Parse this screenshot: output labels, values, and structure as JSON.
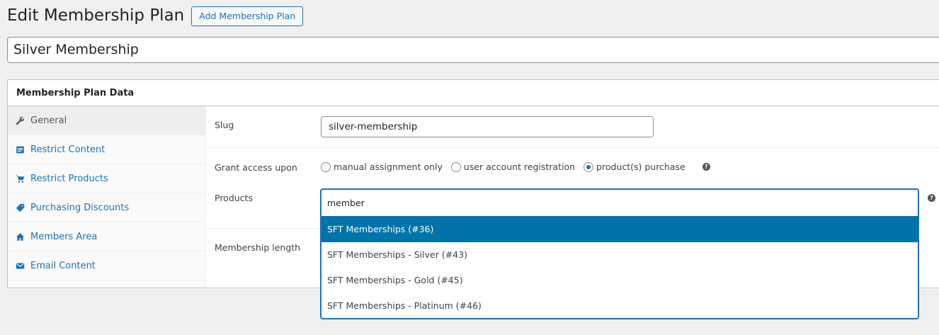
{
  "header": {
    "title": "Edit Membership Plan",
    "add_button_label": "Add Membership Plan"
  },
  "plan_title": {
    "value": "Silver Membership"
  },
  "metabox": {
    "title": "Membership Plan Data",
    "tabs": [
      {
        "label": "General",
        "icon": "wrench-icon",
        "active": true
      },
      {
        "label": "Restrict Content",
        "icon": "document-icon",
        "active": false
      },
      {
        "label": "Restrict Products",
        "icon": "cart-icon",
        "active": false
      },
      {
        "label": "Purchasing Discounts",
        "icon": "tag-icon",
        "active": false
      },
      {
        "label": "Members Area",
        "icon": "home-icon",
        "active": false
      },
      {
        "label": "Email Content",
        "icon": "email-icon",
        "active": false
      }
    ],
    "general": {
      "slug_label": "Slug",
      "slug_value": "silver-membership",
      "grant_label": "Grant access upon",
      "grant_options": [
        {
          "label": "manual assignment only",
          "checked": false
        },
        {
          "label": "user account registration",
          "checked": false
        },
        {
          "label": "product(s) purchase",
          "checked": true
        }
      ],
      "products_label": "Products",
      "products_search": "member",
      "products_options": [
        {
          "label": "SFT Memberships (#36)",
          "highlighted": true
        },
        {
          "label": "SFT Memberships - Silver (#43)",
          "highlighted": false
        },
        {
          "label": "SFT Memberships - Gold (#45)",
          "highlighted": false
        },
        {
          "label": "SFT Memberships - Platinum (#46)",
          "highlighted": false
        }
      ],
      "length_label": "Membership length",
      "help_glyph": "?"
    }
  },
  "colors": {
    "accent": "#2271b1",
    "highlight": "#0073aa",
    "background": "#f0f0f1"
  }
}
